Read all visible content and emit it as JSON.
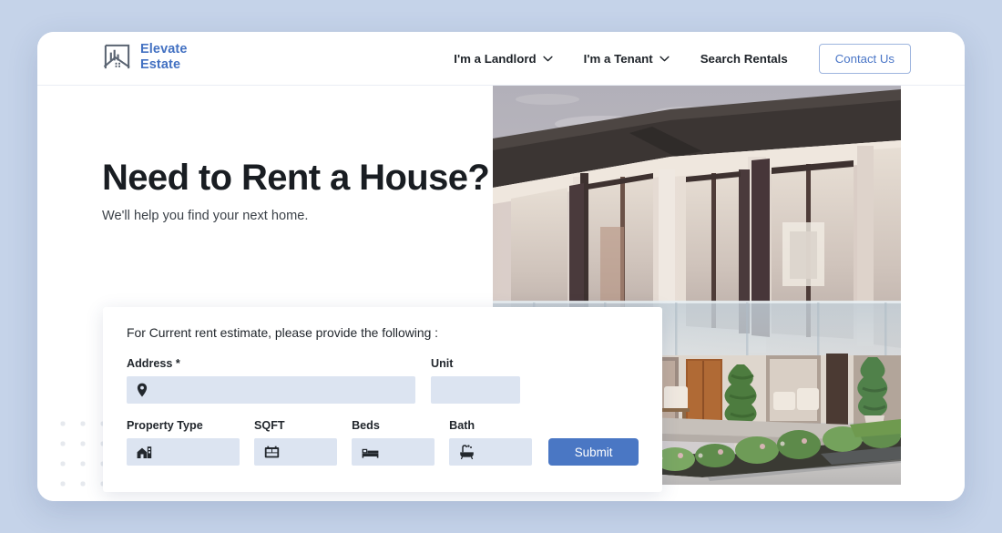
{
  "theme": {
    "page_background": "#c5d3e9",
    "card_background": "#ffffff",
    "brand_blue": "#4371c2",
    "accent_blue": "#4a77c4",
    "input_fill": "#dce4f1",
    "text_dark": "#191d22"
  },
  "header": {
    "logo": {
      "icon": "house-chart-logo-icon",
      "line1": "Elevate",
      "line2": "Estate"
    },
    "nav": [
      {
        "label": "I'm a Landlord",
        "icon": "chevron-down-icon",
        "has_dropdown": true
      },
      {
        "label": "I'm a Tenant",
        "icon": "chevron-down-icon",
        "has_dropdown": true
      },
      {
        "label": "Search Rentals",
        "has_dropdown": false
      }
    ],
    "contact_button": "Contact Us"
  },
  "hero": {
    "title": "Need to Rent a House?",
    "subtitle": "We'll help you find your next home.",
    "photo_alt": "modern-house-exterior-photo"
  },
  "form": {
    "intro": "For Current rent estimate, please provide the following :",
    "fields": [
      {
        "label": "Address *",
        "value": "",
        "placeholder": "",
        "icon": "map-pin-icon"
      },
      {
        "label": "Unit",
        "value": "",
        "placeholder": "",
        "icon": ""
      },
      {
        "label": "Property Type",
        "value": "",
        "placeholder": "",
        "icon": "house-icon"
      },
      {
        "label": "SQFT",
        "value": "",
        "placeholder": "",
        "icon": "floor-plan-icon"
      },
      {
        "label": "Beds",
        "value": "",
        "placeholder": "",
        "icon": "bed-icon"
      },
      {
        "label": "Bath",
        "value": "",
        "placeholder": "",
        "icon": "bathtub-icon"
      }
    ],
    "submit_label": "Submit"
  }
}
